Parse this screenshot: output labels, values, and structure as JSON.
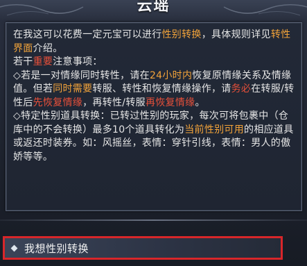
{
  "dialog": {
    "title": "云瑶",
    "intro": {
      "t1": "在我这可以花费一定元宝可以进行",
      "t2": "性别转换",
      "t3": "，具体规则",
      "t4": "详见",
      "t5": "转性界面",
      "t6": "介绍。"
    },
    "notice": {
      "t1": "若干",
      "t2": "重要",
      "t3": "注意事项："
    },
    "rule1": {
      "t1": "◇若是一对情缘同时转性，请在",
      "t2": "24小时内",
      "t3": "恢复原情缘关系及情缘值。但若",
      "t4": "同时需要",
      "t5": "转服、转性和恢复情缘操作，请",
      "t6": "务必",
      "t7": "在转服/转性后",
      "t8": "先恢复情缘",
      "t9": "，再转性/转服",
      "t10": "再恢复情缘",
      "t11": "。"
    },
    "rule2": {
      "t1": "◇特定性别道具转换：已转过性别的玩家，每次可将包裹中（仓库中的不会转换）最多10个道具转化为",
      "t2": "当前性别可用",
      "t3": "的相应道具或返还时装券。如：风摇丝，表情：穿针引线，表情：男人的傲娇等等。"
    },
    "option": {
      "label": "我想性别转换"
    }
  },
  "colors": {
    "highlight_orange": "#f2a33a",
    "highlight_red": "#e8503a",
    "selection_border": "#d8262a"
  }
}
